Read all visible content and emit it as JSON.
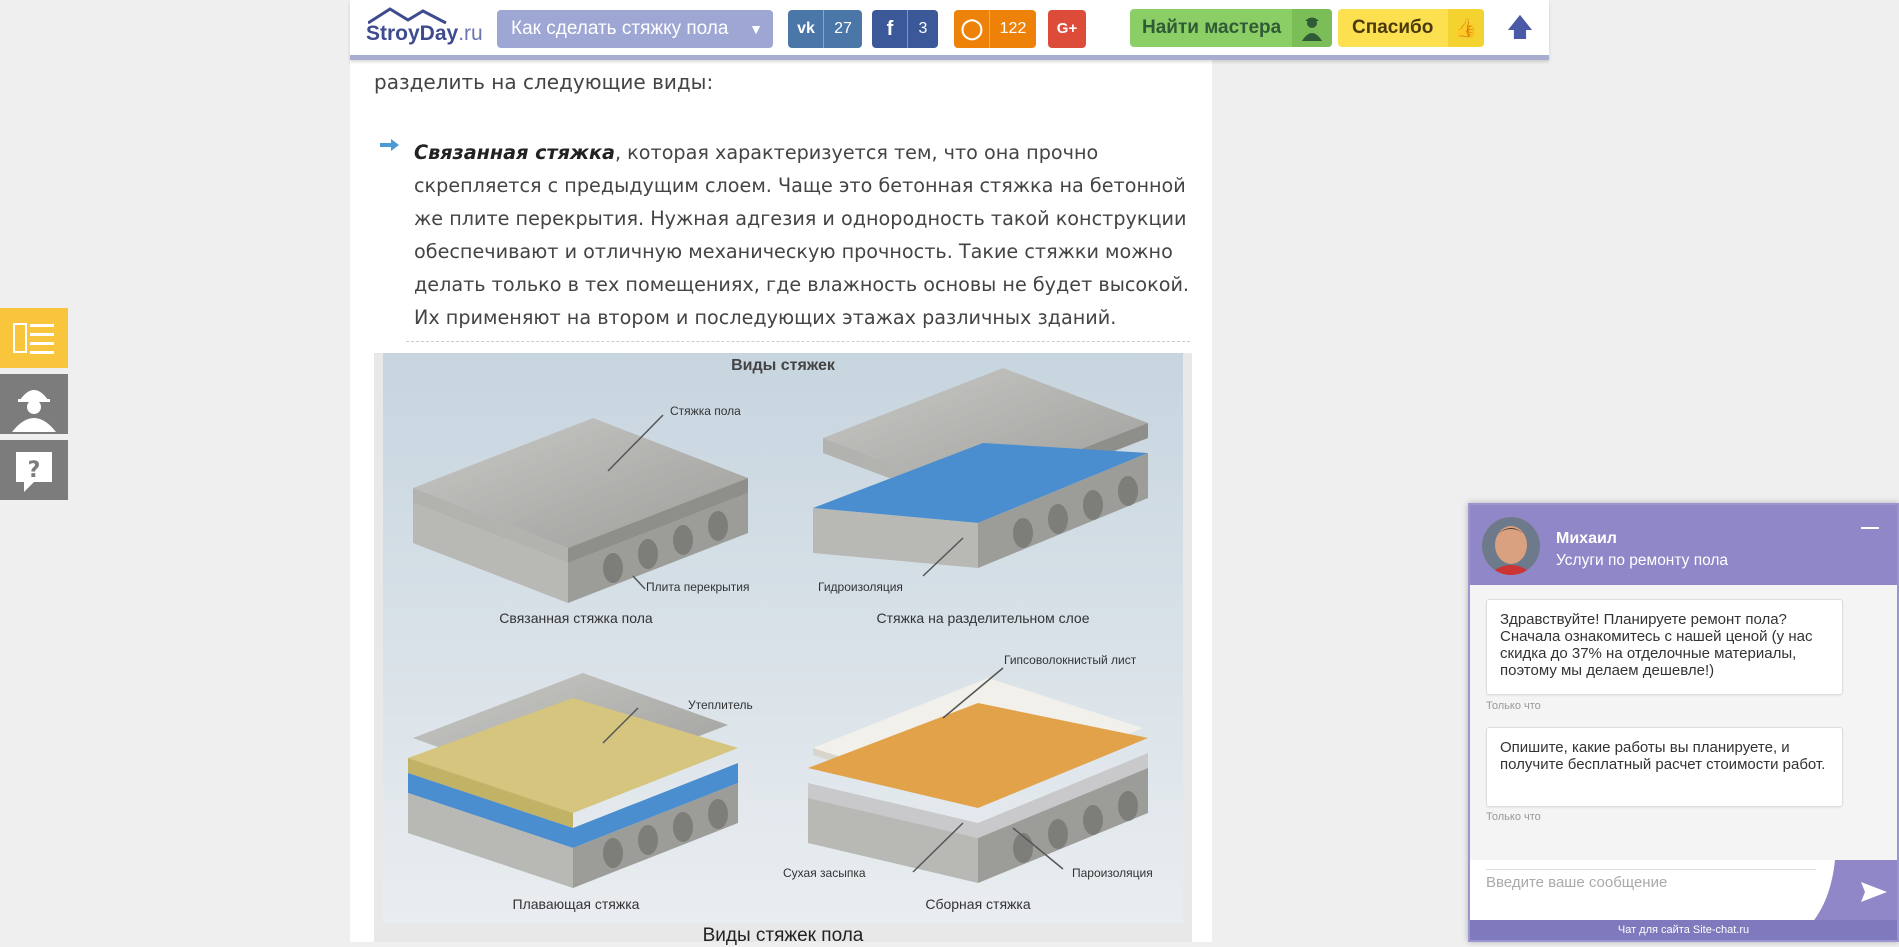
{
  "header": {
    "logo_text": "StroyDay",
    "logo_tld": ".ru",
    "article_select": "Как сделать стяжку пола",
    "share": [
      {
        "network": "vk",
        "icon": "vk-icon",
        "count": "27",
        "color": "#4a76a8"
      },
      {
        "network": "facebook",
        "icon": "facebook-icon",
        "count": "3",
        "color": "#3b5998"
      },
      {
        "network": "odnoklassniki",
        "icon": "odnoklassniki-icon",
        "count": "122",
        "color": "#ee8208"
      },
      {
        "network": "google-plus",
        "icon": "google-plus-icon",
        "count": "",
        "color": "#dd4b39"
      }
    ],
    "find_master_label": "Найти мастера",
    "thanks_label": "Спасибо"
  },
  "article": {
    "lead": "разделить на следующие виды:",
    "bullet_term": "Связанная стяжка",
    "bullet_text": ", которая характеризуется тем, что она прочно скрепляется с предыдущим слоем. Чаще это бетонная стяжка на бетонной же плите перекрытия. Нужная адгезия и однородность такой конструкции обеспечивают и отличную механическую прочность. Такие стяжки можно делать только в тех помещениях, где влажность основы не будет высокой. Их применяют на втором и последующих этажах различных зданий.",
    "figure": {
      "title": "Виды стяжек",
      "labels": {
        "screed": "Стяжка пола",
        "slab": "Плита перекрытия",
        "waterproof": "Гидроизоляция",
        "insulation": "Утеплитель",
        "gypsum": "Гипсоволокнистый лист",
        "dry_fill": "Сухая засыпка",
        "vapor": "Пароизоляция"
      },
      "captions": {
        "bonded": "Связанная стяжка пола",
        "separated": "Стяжка на разделительном слое",
        "floating": "Плавающая стяжка",
        "prefab": "Сборная стяжка"
      }
    },
    "caption": "Виды стяжек пола"
  },
  "side_tabs": [
    {
      "icon": "contents-list-icon",
      "color": "#f8c53c"
    },
    {
      "icon": "builder-icon",
      "color": "#7c7c7c"
    },
    {
      "icon": "question-icon",
      "color": "#7c7c7c"
    }
  ],
  "chat": {
    "agent_name": "Михаил",
    "agent_role": "Услуги по ремонту пола",
    "messages": [
      {
        "text": "Здравствуйте! Планируете ремонт пола? Сначала ознакомитесь с нашей ценой (у нас скидка до 37% на отделочные материалы, поэтому мы делаем дешевле!)",
        "time": "Только что"
      },
      {
        "text": "Опишите, какие работы вы планируете, и получите бесплатный расчет стоимости работ.",
        "time": "Только что"
      }
    ],
    "input_placeholder": "Введите ваше сообщение",
    "footer": "Чат для сайта Site-chat.ru"
  }
}
